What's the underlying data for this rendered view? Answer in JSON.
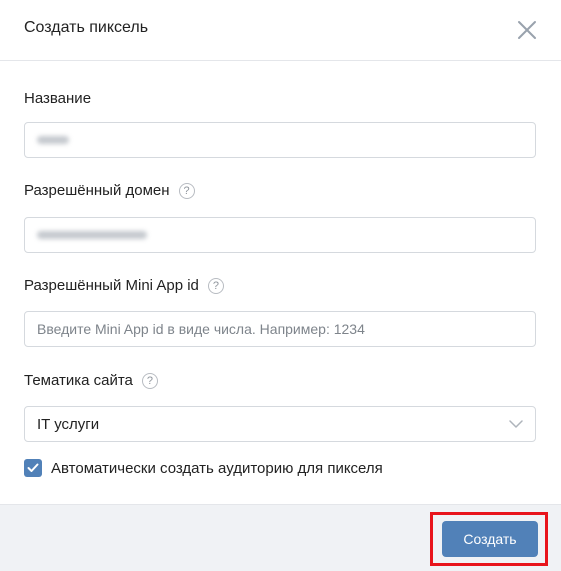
{
  "header": {
    "title": "Создать пиксель"
  },
  "fields": {
    "name": {
      "label": "Название"
    },
    "domain": {
      "label": "Разрешённый домен",
      "help": "?"
    },
    "mini_app": {
      "label": "Разрешённый Mini App id",
      "help": "?",
      "placeholder": "Введите Mini App id в виде числа. Например: 1234"
    },
    "topic": {
      "label": "Тематика сайта",
      "help": "?",
      "value": "IT услуги"
    }
  },
  "checkbox": {
    "checked": true,
    "label": "Автоматически создать аудиторию для пикселя"
  },
  "footer": {
    "create_label": "Создать"
  },
  "colors": {
    "accent": "#5181b8",
    "highlight": "#e8141b",
    "footer_bg": "#f0f2f5"
  }
}
